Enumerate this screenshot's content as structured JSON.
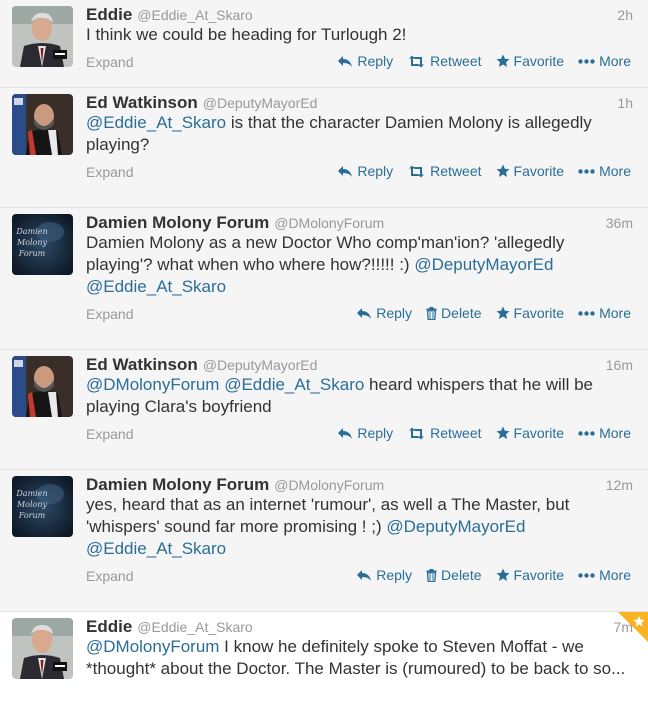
{
  "tweets": [
    {
      "name": "Eddie",
      "handle": "@Eddie_At_Skaro",
      "time": "2h",
      "text_parts": [
        {
          "t": "I think we could be heading for Turlough 2!",
          "m": false
        }
      ],
      "avatar": "eddie",
      "actions": [
        "reply",
        "retweet",
        "favorite",
        "more"
      ],
      "highlight": false,
      "lines": 1
    },
    {
      "name": "Ed Watkinson",
      "handle": "@DeputyMayorEd",
      "time": "1h",
      "text_parts": [
        {
          "t": "@Eddie_At_Skaro",
          "m": true
        },
        {
          "t": " is that the character Damien Molony is allegedly playing?",
          "m": false
        }
      ],
      "avatar": "ed",
      "actions": [
        "reply",
        "retweet",
        "favorite",
        "more"
      ],
      "highlight": false,
      "lines": 2
    },
    {
      "name": "Damien Molony Forum",
      "handle": "@DMolonyForum",
      "time": "36m",
      "text_parts": [
        {
          "t": "Damien Molony as a new Doctor Who comp'man'ion? 'allegedly playing'? what when who where how?!!!!! :)  ",
          "m": false
        },
        {
          "t": "@DeputyMayorEd",
          "m": true
        },
        {
          "t": " ",
          "m": false
        },
        {
          "t": "@Eddie_At_Skaro",
          "m": true
        }
      ],
      "avatar": "forum",
      "actions": [
        "reply",
        "delete",
        "favorite",
        "more"
      ],
      "highlight": false,
      "lines": 3
    },
    {
      "name": "Ed Watkinson",
      "handle": "@DeputyMayorEd",
      "time": "16m",
      "text_parts": [
        {
          "t": "@DMolonyForum",
          "m": true
        },
        {
          "t": " ",
          "m": false
        },
        {
          "t": "@Eddie_At_Skaro",
          "m": true
        },
        {
          "t": " heard whispers that he will be playing Clara's boyfriend",
          "m": false
        }
      ],
      "avatar": "ed",
      "actions": [
        "reply",
        "retweet",
        "favorite",
        "more"
      ],
      "highlight": false,
      "lines": 2
    },
    {
      "name": "Damien Molony Forum",
      "handle": "@DMolonyForum",
      "time": "12m",
      "text_parts": [
        {
          "t": "yes, heard that as an internet 'rumour', as well a The Master, but 'whispers' sound far more promising ! ;) ",
          "m": false
        },
        {
          "t": "@DeputyMayorEd",
          "m": true
        },
        {
          "t": " ",
          "m": false
        },
        {
          "t": "@Eddie_At_Skaro",
          "m": true
        }
      ],
      "avatar": "forum",
      "actions": [
        "reply",
        "delete",
        "favorite",
        "more"
      ],
      "highlight": false,
      "lines": 3
    },
    {
      "name": "Eddie",
      "handle": "@Eddie_At_Skaro",
      "time": "7m",
      "text_parts": [
        {
          "t": "@DMolonyForum",
          "m": true
        },
        {
          "t": " I know he definitely spoke to Steven Moffat - we *thought* about the Doctor. The Master is (rumoured) to be back to so...",
          "m": false
        }
      ],
      "avatar": "eddie",
      "actions": [],
      "highlight": true,
      "lines": 3
    }
  ],
  "labels": {
    "expand": "Expand",
    "reply": "Reply",
    "retweet": "Retweet",
    "favorite": "Favorite",
    "delete": "Delete",
    "more": "More"
  },
  "avatar_text": {
    "forum_lines": [
      "Damien",
      "Molony",
      "Forum"
    ]
  },
  "colors": {
    "link": "#2a6e98",
    "muted": "#999999",
    "tweet_bg": "#f5f5f5",
    "highlight_bg": "#ffffff",
    "star_corner": "#f7b322"
  }
}
